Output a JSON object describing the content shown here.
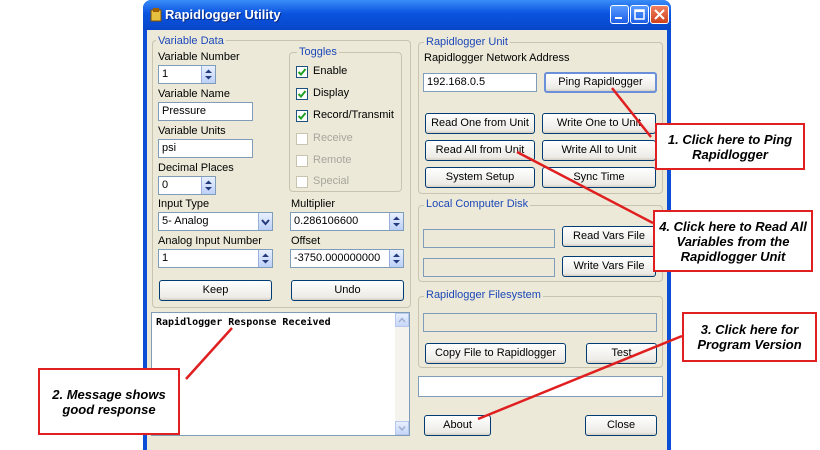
{
  "window": {
    "title": "Rapidlogger Utility"
  },
  "variable_data": {
    "group_label": "Variable Data",
    "variable_number_label": "Variable Number",
    "variable_number_value": "1",
    "variable_name_label": "Variable Name",
    "variable_name_value": "Pressure",
    "variable_units_label": "Variable Units",
    "variable_units_value": "psi",
    "decimal_places_label": "Decimal Places",
    "decimal_places_value": "0",
    "input_type_label": "Input Type",
    "input_type_value": "5- Analog",
    "analog_input_label": "Analog Input Number",
    "analog_input_value": "1",
    "multiplier_label": "Multiplier",
    "multiplier_value": "0.286106600",
    "offset_label": "Offset",
    "offset_value": "-3750.000000000",
    "keep_label": "Keep",
    "undo_label": "Undo"
  },
  "toggles": {
    "group_label": "Toggles",
    "enable": "Enable",
    "display": "Display",
    "record": "Record/Transmit",
    "receive": "Receive",
    "remote": "Remote",
    "special": "Special"
  },
  "unit": {
    "group_label": "Rapidlogger Unit",
    "address_label": "Rapidlogger Network Address",
    "address_value": "192.168.0.5",
    "ping": "Ping Rapidlogger",
    "read_one": "Read One from Unit",
    "write_one": "Write One to Unit",
    "read_all": "Read All from Unit",
    "write_all": "Write All to Unit",
    "system_setup": "System Setup",
    "sync_time": "Sync Time"
  },
  "disk": {
    "group_label": "Local Computer Disk",
    "read_vars": "Read Vars File",
    "write_vars": "Write Vars File"
  },
  "filesystem": {
    "group_label": "Rapidlogger Filesystem",
    "copy_file": "Copy File to Rapidlogger",
    "test": "Test"
  },
  "message": "Rapidlogger Response Received",
  "about": "About",
  "close": "Close",
  "callouts": {
    "c1": "1. Click here to Ping Rapidlogger",
    "c2": "2. Message shows good response",
    "c3": "3. Click here for Program Version",
    "c4": "4. Click here to Read All Variables from the Rapidlogger Unit"
  },
  "colors": {
    "callout_border": "#e02020",
    "titlebar": "#0a54e0",
    "group_label": "#1c48b8"
  }
}
